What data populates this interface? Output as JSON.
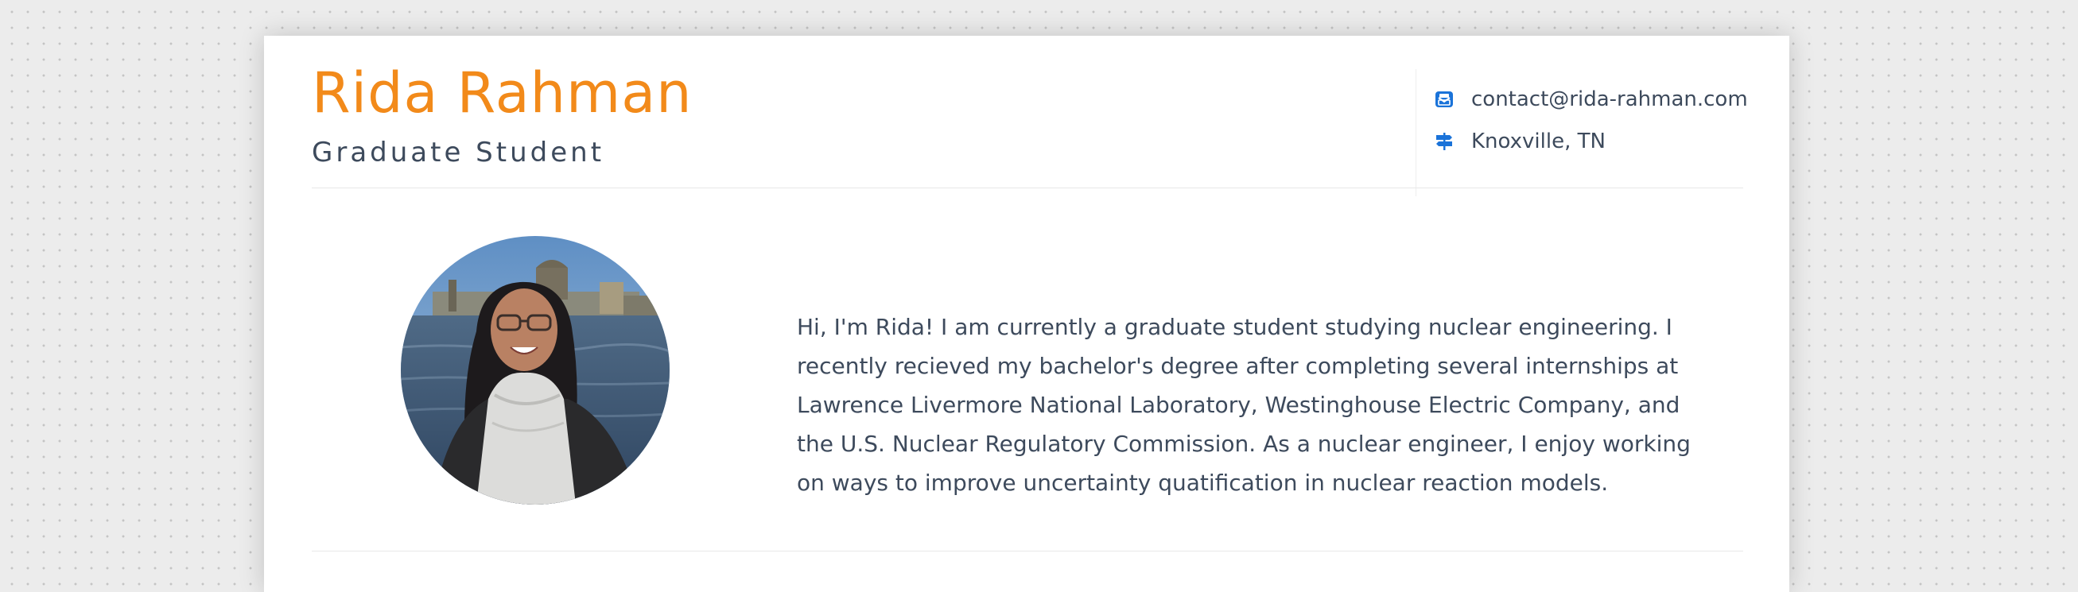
{
  "header": {
    "name": "Rida Rahman",
    "title": "Graduate Student"
  },
  "contact": {
    "email": "contact@rida-rahman.com",
    "email_icon": "envelope-icon",
    "location": "Knoxville, TN",
    "location_icon": "signpost-icon"
  },
  "profile": {
    "photo": "profile-photo",
    "bio": "Hi, I'm Rida! I am currently a graduate student studying nuclear engineering. I recently recieved my bachelor's degree after completing several internships at Lawrence Livermore National Laboratory, Westinghouse Electric Company, and the U.S. Nuclear Regulatory Commission. As a nuclear engineer, I enjoy working on ways to improve uncertainty quatification in nuclear reaction models."
  },
  "colors": {
    "accent": "#f28a1a",
    "text": "#3d4a5c",
    "icon": "#1a73d9"
  }
}
